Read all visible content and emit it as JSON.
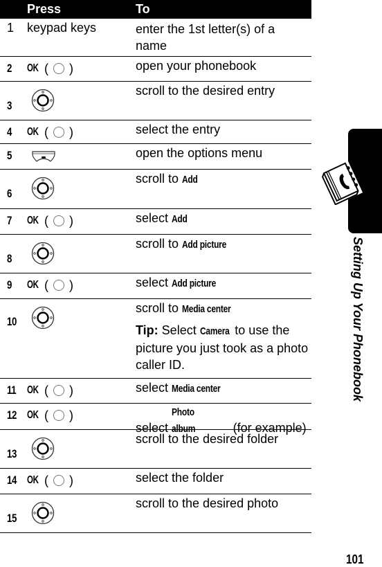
{
  "table": {
    "headers": {
      "press": "Press",
      "to": "To"
    },
    "rows": [
      {
        "num": "1",
        "press": {
          "type": "text",
          "label": "keypad keys"
        },
        "to": [
          {
            "text": "enter the 1st letter(s) of a name"
          }
        ]
      },
      {
        "num": "2",
        "press": {
          "type": "ok",
          "label": "OK"
        },
        "to": [
          {
            "text": "open your phonebook"
          }
        ]
      },
      {
        "num": "3",
        "press": {
          "type": "nav-key"
        },
        "to": [
          {
            "text": "scroll to the desired entry"
          }
        ]
      },
      {
        "num": "4",
        "press": {
          "type": "ok",
          "label": "OK"
        },
        "to": [
          {
            "text": "select the entry"
          }
        ]
      },
      {
        "num": "5",
        "press": {
          "type": "menu-key"
        },
        "to": [
          {
            "text": "open the options menu"
          }
        ]
      },
      {
        "num": "6",
        "press": {
          "type": "nav-key"
        },
        "to": [
          {
            "text": "scroll to ",
            "kw": "Add"
          }
        ]
      },
      {
        "num": "7",
        "press": {
          "type": "ok",
          "label": "OK"
        },
        "to": [
          {
            "text": "select ",
            "kw": "Add"
          }
        ]
      },
      {
        "num": "8",
        "press": {
          "type": "nav-key"
        },
        "to": [
          {
            "text": "scroll to ",
            "kw": "Add picture"
          }
        ]
      },
      {
        "num": "9",
        "press": {
          "type": "ok",
          "label": "OK"
        },
        "to": [
          {
            "text": "select ",
            "kw": "Add picture"
          }
        ]
      },
      {
        "num": "10",
        "press": {
          "type": "nav-key"
        },
        "to": [
          {
            "text": "scroll to ",
            "kw": "Media center"
          }
        ],
        "tip": {
          "label": "Tip:",
          "before": " Select ",
          "kw": "Camera",
          "after": " to use the picture you just took as a photo caller ID."
        }
      },
      {
        "num": "11",
        "press": {
          "type": "ok",
          "label": "OK"
        },
        "to": [
          {
            "text": "select ",
            "kw": "Media center"
          }
        ]
      },
      {
        "num": "12",
        "press": {
          "type": "ok",
          "label": "OK"
        },
        "to": [
          {
            "text": "select ",
            "kw": "Photo album",
            "after": " (for example)"
          }
        ]
      },
      {
        "num": "13",
        "press": {
          "type": "nav-key"
        },
        "to": [
          {
            "text": "scroll to the desired folder"
          }
        ]
      },
      {
        "num": "14",
        "press": {
          "type": "ok",
          "label": "OK"
        },
        "to": [
          {
            "text": "select the folder"
          }
        ]
      },
      {
        "num": "15",
        "press": {
          "type": "nav-key"
        },
        "to": [
          {
            "text": "scroll to the desired photo"
          }
        ]
      }
    ]
  },
  "side_tab": {
    "title": "Setting Up Your Phonebook",
    "icon": "phonebook-icon"
  },
  "page_number": "101"
}
